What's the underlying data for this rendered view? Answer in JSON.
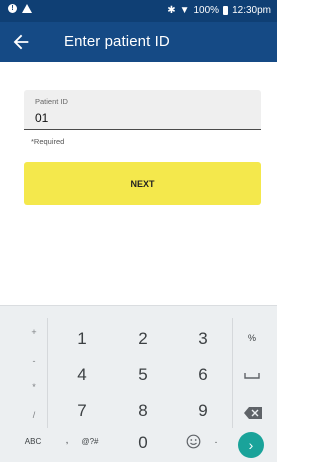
{
  "status": {
    "battery": "100%",
    "time": "12:30pm"
  },
  "app_bar": {
    "title": "Enter patient ID"
  },
  "form": {
    "label": "Patient ID",
    "value": "01",
    "helper": "*Required",
    "button": "NEXT"
  },
  "keyboard": {
    "left": [
      "+",
      "-",
      "*",
      "/"
    ],
    "row1": [
      "1",
      "2",
      "3"
    ],
    "row2": [
      "4",
      "5",
      "6"
    ],
    "row3": [
      "7",
      "8",
      "9"
    ],
    "right": [
      "%"
    ],
    "bottom": {
      "abc": "ABC",
      "comma": ",",
      "symbols": "@?#",
      "zero": "0",
      "period": "."
    }
  },
  "colors": {
    "status_bar": "#0f3f74",
    "app_bar": "#154a85",
    "button": "#f4e84c",
    "go": "#1aa39a"
  }
}
